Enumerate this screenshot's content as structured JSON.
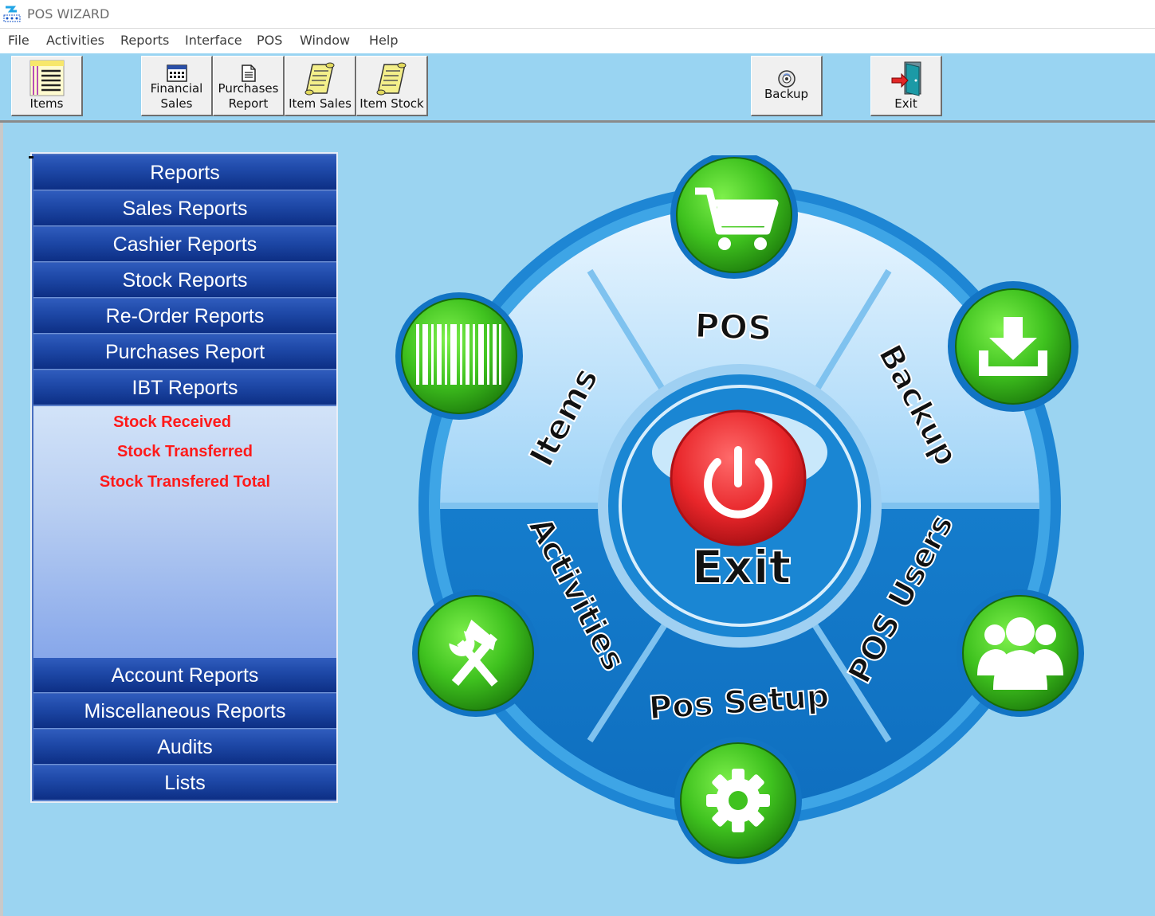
{
  "window": {
    "title": "POS WIZARD",
    "icon": "pos-wizard-app-icon"
  },
  "menu": [
    "File",
    "Activities",
    "Reports",
    "Interface",
    "POS",
    "Window",
    "Help"
  ],
  "toolbar": {
    "items_label": "Items",
    "financial_sales_label_1": "Financial",
    "financial_sales_label_2": "Sales",
    "purchases_report_label_1": "Purchases",
    "purchases_report_label_2": "Report",
    "item_sales_label": "Item Sales",
    "item_stock_label": "Item Stock",
    "backup_label": "Backup",
    "exit_label": "Exit"
  },
  "reports_panel": {
    "header": "Reports",
    "top_buttons": [
      "Sales Reports",
      "Cashier Reports",
      "Stock Reports",
      "Re-Order Reports",
      "Purchases Report",
      "IBT Reports"
    ],
    "ibt_sub_items": [
      "Stock Received",
      "Stock Transferred",
      "Stock Transfered Total"
    ],
    "bottom_buttons": [
      "Account Reports",
      "Miscellaneous Reports",
      "Audits",
      "Lists"
    ]
  },
  "wheel": {
    "center_label": "Exit",
    "segments": [
      "POS",
      "Backup",
      "POS Users",
      "Pos Setup",
      "Activities",
      "Items"
    ],
    "icons": [
      "shopping-cart-icon",
      "download-icon",
      "users-icon",
      "gear-icon",
      "tools-icon",
      "barcode-icon",
      "power-icon"
    ]
  },
  "colors": {
    "toolbar_bg": "#99d4f2",
    "main_bg": "#9bd4f1",
    "report_button": "#1d47a6",
    "sub_item_text": "#ff1a1a",
    "wheel_blue": "#1a86d3",
    "wheel_green": "#3fc21f",
    "exit_red": "#e8262a"
  }
}
